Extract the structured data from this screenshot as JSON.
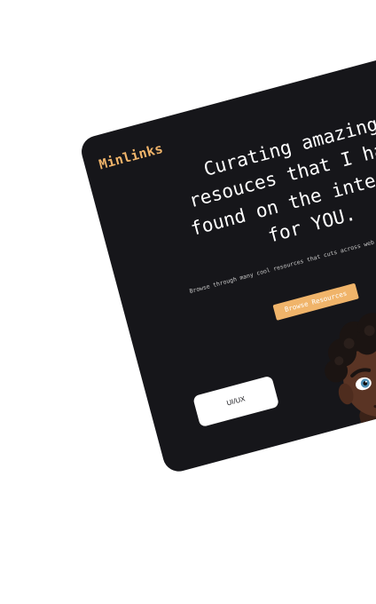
{
  "brand": {
    "logo_text": "Minlinks"
  },
  "hero": {
    "headline": "Curating amazing\nresouces that I have\nfound on the internet\nfor YOU.",
    "subtitle": "Browse through many cool resources that cuts across web design and other fields.",
    "cta_label": "Browse Resources"
  },
  "tags": [
    {
      "label": "UI/UX"
    }
  ],
  "colors": {
    "background": "#ffffff",
    "card": "#16161a",
    "accent": "#f0b46a",
    "text": "#ffffff"
  },
  "icons": {
    "avatar": "memoji-avatar"
  }
}
